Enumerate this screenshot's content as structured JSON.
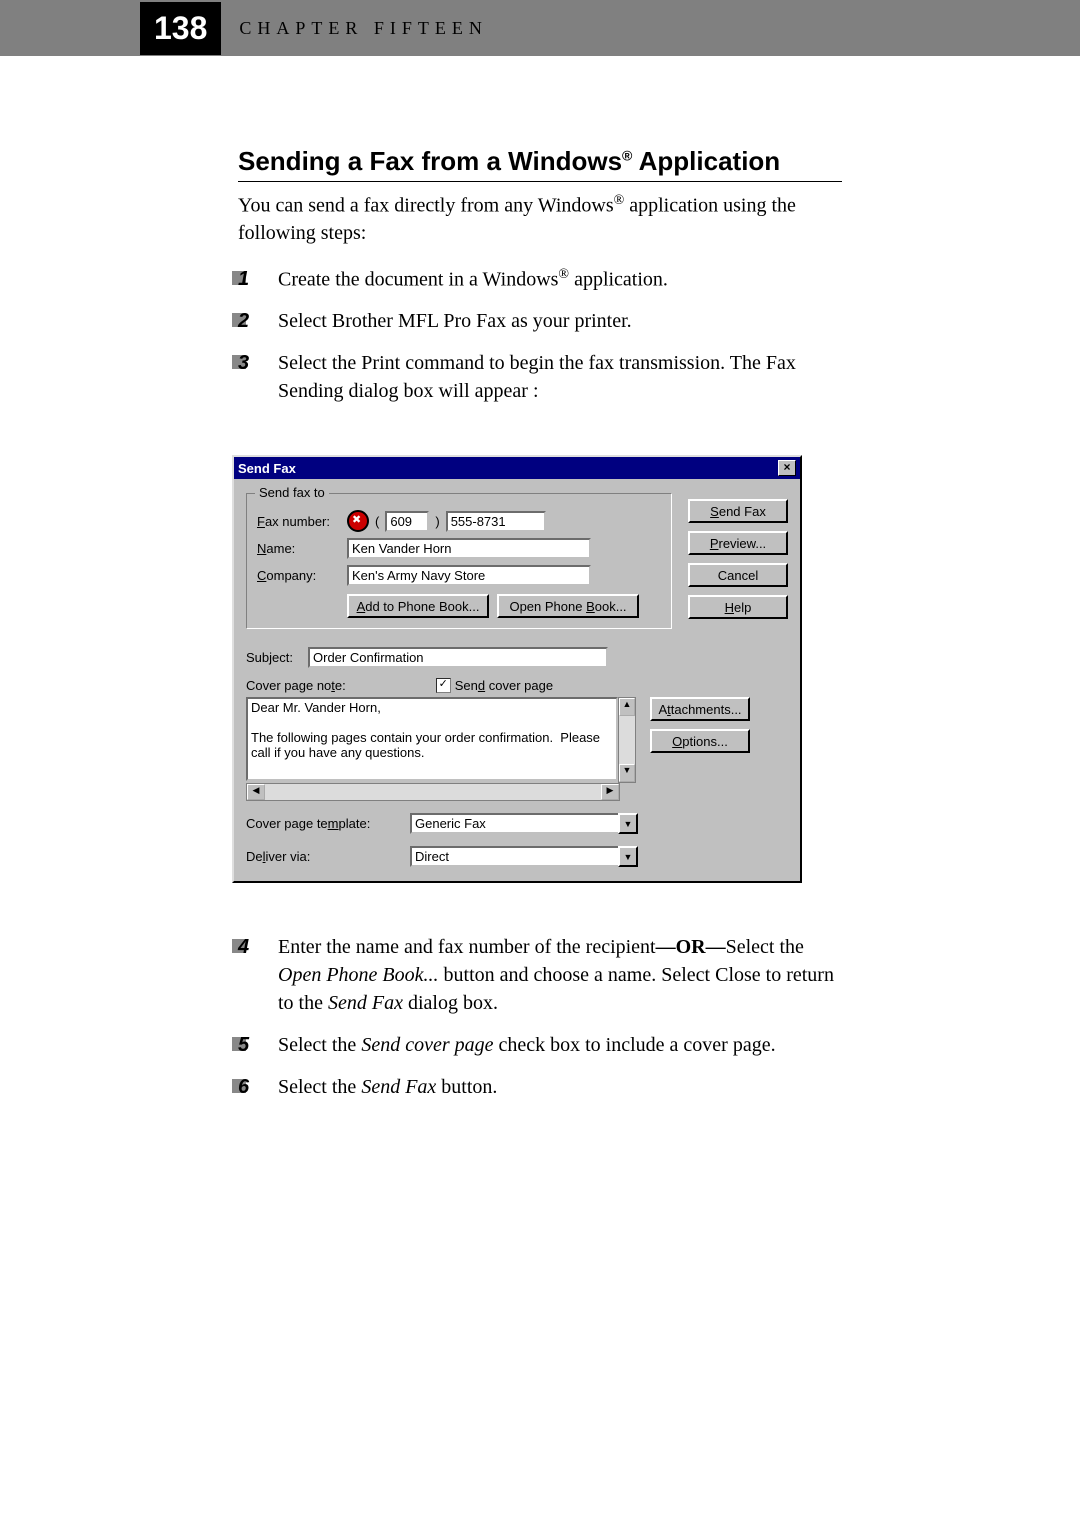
{
  "header": {
    "page_number": "138",
    "chapter_label": "CHAPTER FIFTEEN"
  },
  "section": {
    "title_pre": "Sending a Fax from a Windows",
    "title_post": " Application",
    "reg": "®",
    "intro_1": "You can send a fax directly from any Windows",
    "intro_2": " application using the following steps:"
  },
  "steps_top": [
    {
      "n": "1",
      "pre": "Create the document in a Windows",
      "reg": "®",
      "post": " application."
    },
    {
      "n": "2",
      "pre": "Select Brother MFL Pro Fax as your printer.",
      "reg": "",
      "post": ""
    },
    {
      "n": "3",
      "pre": "Select the Print command to begin the fax transmission.  The Fax Sending dialog box will appear :",
      "reg": "",
      "post": ""
    }
  ],
  "dialog": {
    "title": "Send Fax",
    "close": "×",
    "group_legend": "Send fax to",
    "labels": {
      "fax_number": "Fax number:",
      "name": "Name:",
      "company": "Company:",
      "subject": "Subject:",
      "cover_note": "Cover page note:",
      "send_cover": " Send cover page",
      "template": "Cover page template:",
      "deliver": "Deliver via:"
    },
    "values": {
      "area": "609",
      "local": "555-8731",
      "name": "Ken Vander Horn",
      "company": "Ken's Army Navy Store",
      "subject": "Order Confirmation",
      "note": "Dear Mr. Vander Horn,\n\nThe following pages contain your order confirmation.  Please call if you have any questions.",
      "template": "Generic Fax",
      "deliver": "Direct",
      "paren_open": "(",
      "paren_close": ")",
      "check": "✓",
      "up": "▲",
      "down": "▼",
      "left": "◀",
      "right": "▶"
    },
    "buttons": {
      "send_fax": "Send Fax",
      "preview": "Preview...",
      "cancel": "Cancel",
      "help": "Help",
      "add_pb": "Add to Phone Book...",
      "open_pb": "Open Phone Book...",
      "attachments": "Attachments...",
      "options": "Options..."
    }
  },
  "steps_bottom": [
    {
      "n": "4",
      "html": "Enter the name and fax number of the recipient<b>—OR—</b>Select the <i>Open Phone Book...</i> button and choose a name.  Select Close to return to the <i>Send Fax</i> dialog box."
    },
    {
      "n": "5",
      "html": "Select the <i>Send cover page</i> check box to include a cover page."
    },
    {
      "n": "6",
      "html": "Select the <i>Send Fax</i> button."
    }
  ]
}
